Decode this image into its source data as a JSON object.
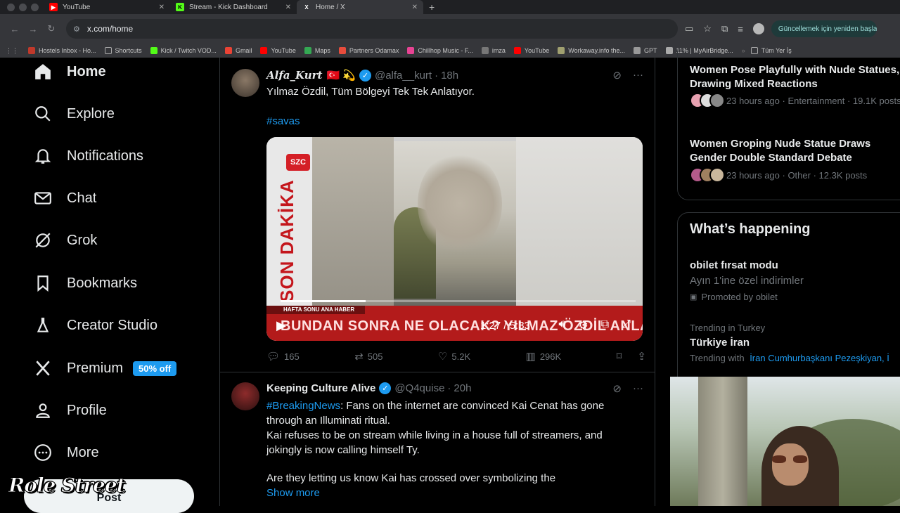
{
  "browser": {
    "tabs": [
      {
        "title": "YouTube",
        "color": "#ff0000",
        "glyph": "▶"
      },
      {
        "title": "Stream - Kick Dashboard",
        "color": "#53fc18",
        "glyph": "K"
      },
      {
        "title": "Home / X",
        "color": "#000000",
        "glyph": "𝕏"
      }
    ],
    "url": "x.com/home",
    "update_text": "Güncellemek için yeniden başlat",
    "bookmarks": [
      {
        "label": "Hostels Inbox - Ho...",
        "color": "#c0392b"
      },
      {
        "label": "Shortcuts",
        "color": "#555"
      },
      {
        "label": "Kick / Twitch VOD...",
        "color": "#53fc18"
      },
      {
        "label": "Gmail",
        "color": "#ea4335"
      },
      {
        "label": "YouTube",
        "color": "#ff0000"
      },
      {
        "label": "Maps",
        "color": "#34a853"
      },
      {
        "label": "Partners Odamax",
        "color": "#e74c3c"
      },
      {
        "label": "Chillhop Music - F...",
        "color": "#e84393"
      },
      {
        "label": "imza",
        "color": "#777"
      },
      {
        "label": "YouTube",
        "color": "#ff0000"
      },
      {
        "label": "Workaway.info the...",
        "color": "#a0a070"
      },
      {
        "label": "GPT",
        "color": "#999"
      },
      {
        "label": "11% | MyAirBridge...",
        "color": "#aaa"
      }
    ],
    "bookmarks_more": "Tüm Yer İş"
  },
  "nav": {
    "items": [
      {
        "label": "Home",
        "icon": "home-icon"
      },
      {
        "label": "Explore",
        "icon": "search-icon"
      },
      {
        "label": "Notifications",
        "icon": "bell-icon"
      },
      {
        "label": "Chat",
        "icon": "mail-icon"
      },
      {
        "label": "Grok",
        "icon": "grok-icon"
      },
      {
        "label": "Bookmarks",
        "icon": "bookmark-icon"
      },
      {
        "label": "Creator Studio",
        "icon": "flask-icon"
      },
      {
        "label": "Premium",
        "icon": "x-logo-icon"
      },
      {
        "label": "Profile",
        "icon": "person-icon"
      },
      {
        "label": "More",
        "icon": "more-circle-icon"
      }
    ],
    "premium_badge": "50% off",
    "post_label": "Post",
    "watermark": "Role Street"
  },
  "tweets": [
    {
      "name": "Alfa_Kurt",
      "emojis": "🇹🇷 💫",
      "handle": "@alfa__kurt",
      "time": "18h",
      "text": "Yılmaz Özdil, Tüm Bölgeyi Tek Tek Anlatıyor.",
      "hashtag": "#savas",
      "video": {
        "channel_logo": "SZC",
        "side_text": "SON DAKİKA",
        "program": "HAFTA SONU ANA HABER",
        "ticker": "BUNDAN SONRA NE OLACAK? YILMAZ ÖZDİL ANLATIYOR",
        "time": "1:27 / 5:33",
        "progress": 0.24
      },
      "replies": "165",
      "reposts": "505",
      "likes": "5.2K",
      "views": "296K"
    },
    {
      "name": "Keeping Culture Alive",
      "handle": "@Q4quise",
      "time": "20h",
      "hashtag": "#BreakingNews",
      "line1": ": Fans on the internet are convinced Kai Cenat has gone through an Illuminati ritual.",
      "line2": "Kai refuses to be on stream while living in a house full of streamers, and jokingly is now calling himself Ty.",
      "line3": "Are they letting us know Kai has crossed over symbolizing the",
      "show_more": "Show more"
    }
  ],
  "trends": {
    "news": [
      {
        "title": "Women Pose Playfully with Nude Statues, Drawing Mixed Reactions",
        "meta": "23 hours ago · Entertainment · 19.1K posts"
      },
      {
        "title": "Women Groping Nude Statue Draws Gender Double Standard Debate",
        "meta": "23 hours ago · Other · 12.3K posts"
      }
    ],
    "whats_happening": "What’s happening",
    "promo_title": "obilet fırsat modu",
    "promo_sub": "Ayın 1'ine özel indirimler",
    "promo_by": "Promoted by obilet",
    "trend_context": "Trending in Turkey",
    "trend_title": "Türkiye İran",
    "trend_with_label": "Trending with",
    "trend_with": "İran Cumhurbaşkanı Pezeşkiyan, İ"
  },
  "colors": {
    "accent": "#1d9bf0",
    "background": "#000000",
    "border": "#2f3336",
    "muted": "#71767b"
  }
}
